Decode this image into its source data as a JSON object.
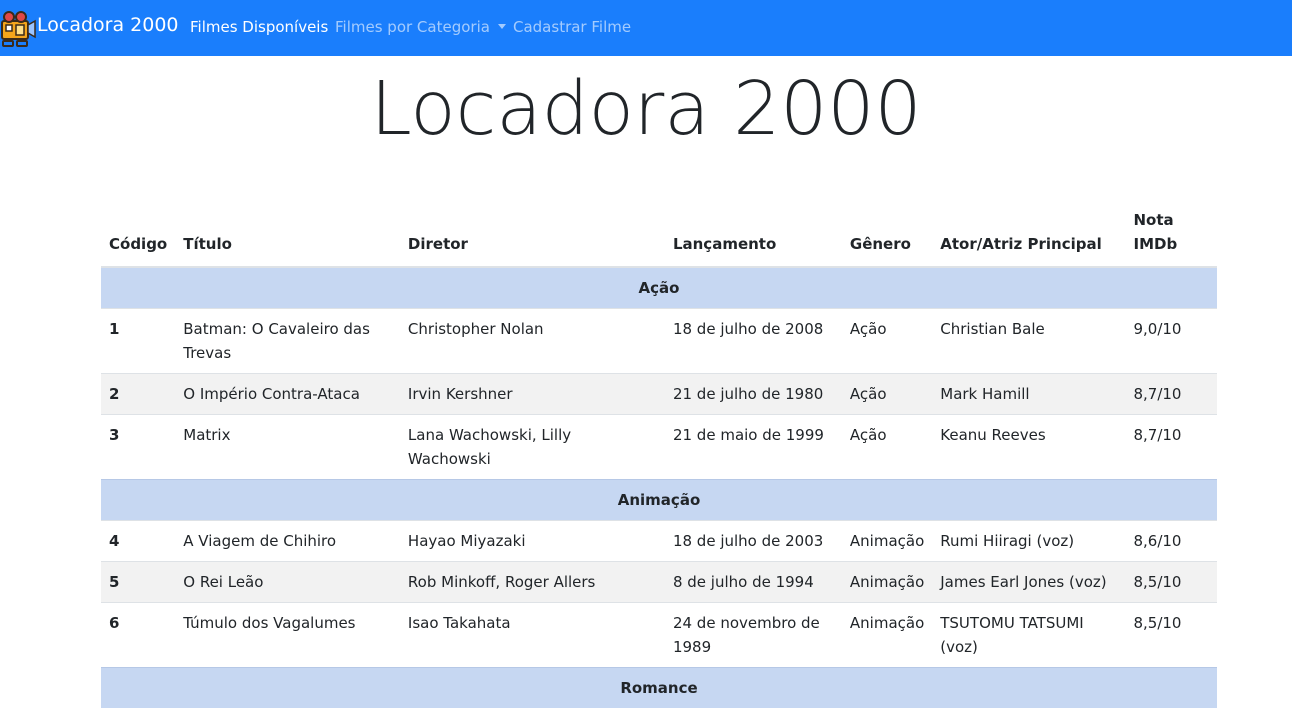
{
  "navbar": {
    "brand": "Locadora 2000",
    "links": [
      {
        "label": "Filmes Disponíveis"
      },
      {
        "label": "Filmes por Categoria"
      },
      {
        "label": "Cadastrar Filme"
      }
    ]
  },
  "page": {
    "title": "Locadora 2000"
  },
  "table": {
    "headers": [
      "Código",
      "Título",
      "Diretor",
      "Lançamento",
      "Gênero",
      "Ator/Atriz Principal",
      "Nota IMDb"
    ],
    "groups": [
      {
        "category": "Ação",
        "rows": [
          {
            "code": "1",
            "title": "Batman: O Cavaleiro das Trevas",
            "director": "Christopher Nolan",
            "release": "18 de julho de 2008",
            "genre": "Ação",
            "actor": "Christian Bale",
            "rating": "9,0/10"
          },
          {
            "code": "2",
            "title": "O Império Contra-Ataca",
            "director": "Irvin Kershner",
            "release": "21 de julho de 1980",
            "genre": "Ação",
            "actor": "Mark Hamill",
            "rating": "8,7/10"
          },
          {
            "code": "3",
            "title": "Matrix",
            "director": "Lana Wachowski, Lilly Wachowski",
            "release": "21 de maio de 1999",
            "genre": "Ação",
            "actor": "Keanu Reeves",
            "rating": "8,7/10"
          }
        ]
      },
      {
        "category": "Animação",
        "rows": [
          {
            "code": "4",
            "title": "A Viagem de Chihiro",
            "director": "Hayao Miyazaki",
            "release": "18 de julho de 2003",
            "genre": "Animação",
            "actor": "Rumi Hiiragi (voz)",
            "rating": "8,6/10"
          },
          {
            "code": "5",
            "title": "O Rei Leão",
            "director": "Rob Minkoff, Roger Allers",
            "release": "8 de julho de 1994",
            "genre": "Animação",
            "actor": "James Earl Jones (voz)",
            "rating": "8,5/10"
          },
          {
            "code": "6",
            "title": "Túmulo dos Vagalumes",
            "director": "Isao Takahata",
            "release": "24 de novembro de 1989",
            "genre": "Animação",
            "actor": "TSUTOMU TATSUMI (voz)",
            "rating": "8,5/10"
          }
        ]
      },
      {
        "category": "Romance",
        "rows": []
      }
    ]
  },
  "colors": {
    "navbar": "#1a7efc",
    "category_row": "#c6d7f2",
    "striped_row": "#f2f2f2"
  }
}
